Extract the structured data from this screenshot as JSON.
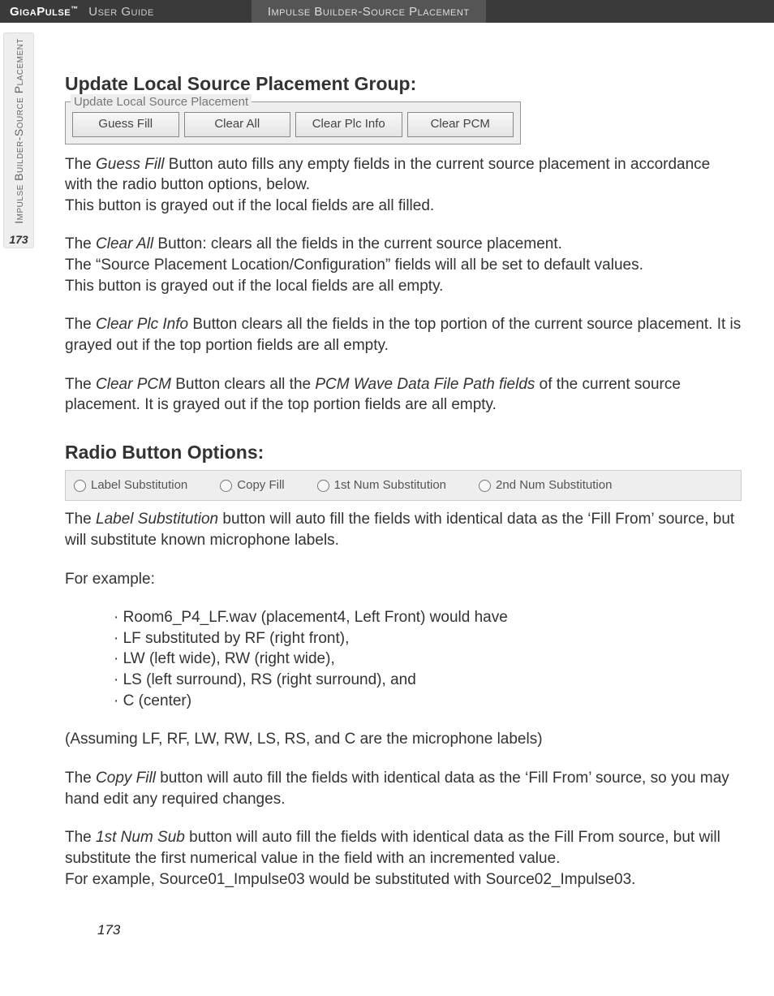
{
  "header": {
    "brand": "GigaPulse",
    "tm": "™",
    "guide": "User Guide",
    "section": "Impulse Builder-Source Placement"
  },
  "sidetab": {
    "label": "Impulse Builder-Source Placement",
    "page": "173"
  },
  "sect1_title": " Update Local Source Placement Group:",
  "fieldset_legend": "Update Local Source Placement",
  "buttons": {
    "guess": "Guess Fill",
    "clear_all": "Clear All",
    "clear_plc": "Clear Plc Info",
    "clear_pcm": "Clear PCM"
  },
  "para1a": "The ",
  "para1_em": "Guess Fill",
  "para1b": " Button auto fills any empty fields in the current source placement in accordance with the radio button options, below.",
  "para1c": "This button is grayed out if the local fields are all filled.",
  "para2a": "The ",
  "para2_em": "Clear All",
  "para2b": " Button: clears all the fields in the current source placement.",
  "para2c": "The “Source Placement Location/Configuration” fields will all be set to default values.",
  "para2d": "This button is grayed out if the local fields are all empty.",
  "para3a": "The ",
  "para3_em": "Clear Plc Info",
  "para3b": " Button clears all the fields in the top portion of the current source placement.  It is grayed out if the top portion fields are all empty.",
  "para4a": "The ",
  "para4_em1": "Clear PCM",
  "para4b": " Button clears all the ",
  "para4_em2": "PCM Wave Data File Path fields",
  "para4c": " of the current source placement.  It is grayed out if the top portion fields are all empty.",
  "sect2_title": "Radio Button Options:",
  "radios": {
    "r1": "Label Substitution",
    "r2": "Copy Fill",
    "r3": "1st Num Substitution",
    "r4": "2nd Num Substitution"
  },
  "para5a": "The ",
  "para5_em": "Label Substitution",
  "para5b": " button will auto fill the fields with identical data as the ‘Fill From’ source, but will substitute known microphone labels.",
  "para6": "For example:",
  "bullets": [
    "Room6_P4_LF.wav (placement4, Left Front) would have",
    "LF substituted by RF (right front),",
    "LW (left wide), RW (right wide),",
    "LS (left surround), RS (right surround), and",
    "C (center)"
  ],
  "para7": "(Assuming LF, RF, LW, RW, LS, RS, and C are the microphone labels)",
  "para8a": "The ",
  "para8_em": "Copy Fill",
  "para8b": " button will auto fill the fields with identical data as the ‘Fill From’ source, so you may hand edit any required changes.",
  "para9a": "The ",
  "para9_em": "1st Num Sub",
  "para9b": " button will auto fill the fields with identical data as the Fill From source, but will substitute the first numerical value in the field with an incremented value.",
  "para9c": "For example, Source01_Impulse03 would be substituted with Source02_Impulse03.",
  "footer_page": "173"
}
